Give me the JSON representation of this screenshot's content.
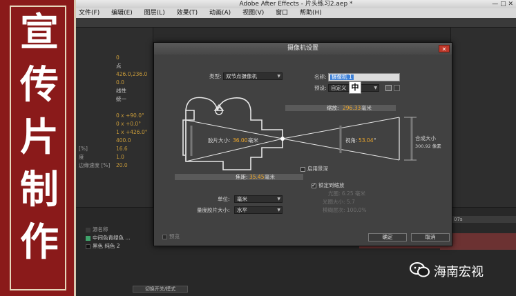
{
  "banner": {
    "chars": [
      "宣",
      "传",
      "片",
      "制",
      "作"
    ]
  },
  "app": {
    "window_title": "Adobe After Effects - 片头练习2.aep *",
    "window_controls": "— □ ✕",
    "menu": [
      "文件(F)",
      "编辑(E)",
      "图层(L)",
      "效果(T)",
      "动画(A)",
      "视图(V)",
      "窗口",
      "帮助(H)"
    ],
    "left_panel_rows": [
      {
        "label": "",
        "value": "0"
      },
      {
        "label": "",
        "value": "点"
      },
      {
        "label": "",
        "value": "426.0,236.0"
      },
      {
        "label": "",
        "value": "0.0"
      },
      {
        "label": "",
        "value": "线性"
      },
      {
        "label": "",
        "value": "统一"
      },
      {
        "label": "",
        "value": ""
      },
      {
        "label": "",
        "value": "0 x +90.0°"
      },
      {
        "label": "",
        "value": "0 x +0.0°"
      },
      {
        "label": "",
        "value": "1 x +426.0°"
      },
      {
        "label": "",
        "value": "400.0"
      },
      {
        "label": "[%]",
        "value": "16.6"
      },
      {
        "label": "度",
        "value": "1.0"
      },
      {
        "label": "边缘速度 [%]",
        "value": "20.0"
      }
    ],
    "timeline_layers": [
      {
        "name": "源名称",
        "color": "#3a3a3a"
      },
      {
        "name": "中间色青绿色 ...",
        "color": "#3fa36b"
      },
      {
        "name": "黑色 纯色 2",
        "color": "#111111"
      }
    ],
    "timeline_ruler": "07s",
    "timeline_toggle": "切换开关/模式"
  },
  "dialog": {
    "title": "摄像机设置",
    "close": "✕",
    "type_label": "类型:",
    "type_value": "双节点摄像机",
    "name_label": "名称:",
    "name_value": "摄像机 1",
    "preset_label": "预设:",
    "preset_value": "自定义",
    "ime_char": "中",
    "zoom_label": "缩放:",
    "zoom_value": "296.33",
    "zoom_unit": "毫米",
    "film_size_label": "胶片大小:",
    "film_size_value": "36.00",
    "film_size_unit": "毫米",
    "view_angle_label": "视角:",
    "view_angle_value": "53.04",
    "view_angle_unit": "°",
    "comp_size_label": "合成大小",
    "comp_size_value": "300.92 像素",
    "focal_label": "焦距:",
    "focal_value": "35.45",
    "focal_unit": "毫米",
    "dof_label": "启用景深",
    "lock_zoom_label": "锁定到缩放",
    "dof_info": [
      "光圈: 6.25 毫米",
      "光圈大小: 5.7",
      "模糊层次: 100.0%"
    ],
    "units_label": "单位:",
    "units_value": "毫米",
    "film_measure_label": "量度胶片大小:",
    "film_measure_value": "水平",
    "ok": "确定",
    "cancel": "取消",
    "preview": "预览"
  },
  "watermark": {
    "text": "海南宏视"
  }
}
